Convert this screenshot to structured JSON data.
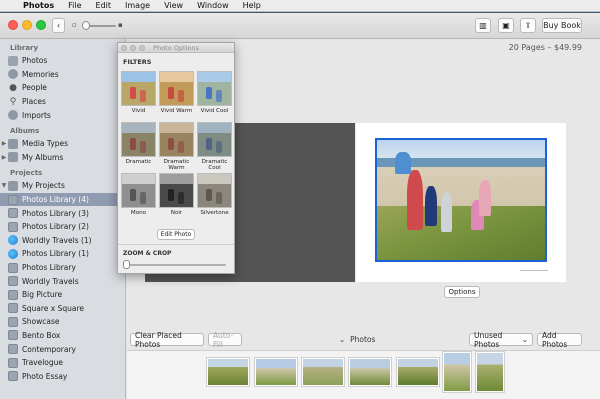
{
  "menubar": {
    "apple": "",
    "items": [
      "Photos",
      "File",
      "Edit",
      "Image",
      "View",
      "Window",
      "Help"
    ]
  },
  "toolbar": {
    "back_icon": "chevron-left-icon",
    "buy_book": "Buy Book"
  },
  "sidebar": {
    "library_header": "Library",
    "library_items": [
      {
        "label": "Photos",
        "icon": "photos-icon"
      },
      {
        "label": "Memories",
        "icon": "memories-icon"
      },
      {
        "label": "People",
        "icon": "people-icon"
      },
      {
        "label": "Places",
        "icon": "places-icon"
      },
      {
        "label": "Imports",
        "icon": "imports-icon"
      }
    ],
    "albums_header": "Albums",
    "album_items": [
      {
        "label": "Media Types"
      },
      {
        "label": "My Albums"
      }
    ],
    "projects_header": "Projects",
    "projects_root": "My Projects",
    "project_items": [
      {
        "label": "Photos Library (4)",
        "selected": true,
        "icon": "book-icon"
      },
      {
        "label": "Photos Library (3)",
        "icon": "book-icon"
      },
      {
        "label": "Photos Library (2)",
        "icon": "book-icon"
      },
      {
        "label": "Worldly Travels (1)",
        "icon": "globe-icon"
      },
      {
        "label": "Photos Library (1)",
        "icon": "globe-icon"
      },
      {
        "label": "Photos Library",
        "icon": "book-icon"
      },
      {
        "label": "Worldly Travels",
        "icon": "book-icon"
      },
      {
        "label": "Big Picture",
        "icon": "book-icon"
      },
      {
        "label": "Square x Square",
        "icon": "book-icon"
      },
      {
        "label": "Showcase",
        "icon": "book-icon"
      },
      {
        "label": "Bento Box",
        "icon": "book-icon"
      },
      {
        "label": "Contemporary",
        "icon": "book-icon"
      },
      {
        "label": "Travelogue",
        "icon": "book-icon"
      },
      {
        "label": "Photo Essay",
        "icon": "book-icon"
      }
    ]
  },
  "main": {
    "page_info": "20 Pages – $49.99",
    "options_button": "Options",
    "clear_button": "Clear Placed Photos",
    "autofill_button": "Auto-Fill",
    "photos_label": "Photos",
    "unused_select": "Unused Photos",
    "add_photos_button": "Add Photos"
  },
  "panel": {
    "title": "Photo Options",
    "filters_header": "FILTERS",
    "filters": [
      "Vivid",
      "Vivid Warm",
      "Vivid Cool",
      "Dramatic",
      "Dramatic Warm",
      "Dramatic Cool",
      "Mono",
      "Noir",
      "Silvertone"
    ],
    "edit_button": "Edit Photo",
    "zoom_header": "ZOOM & CROP"
  },
  "colors": {
    "selection": "#8f9bb0",
    "photo_border": "#1b62d9"
  }
}
